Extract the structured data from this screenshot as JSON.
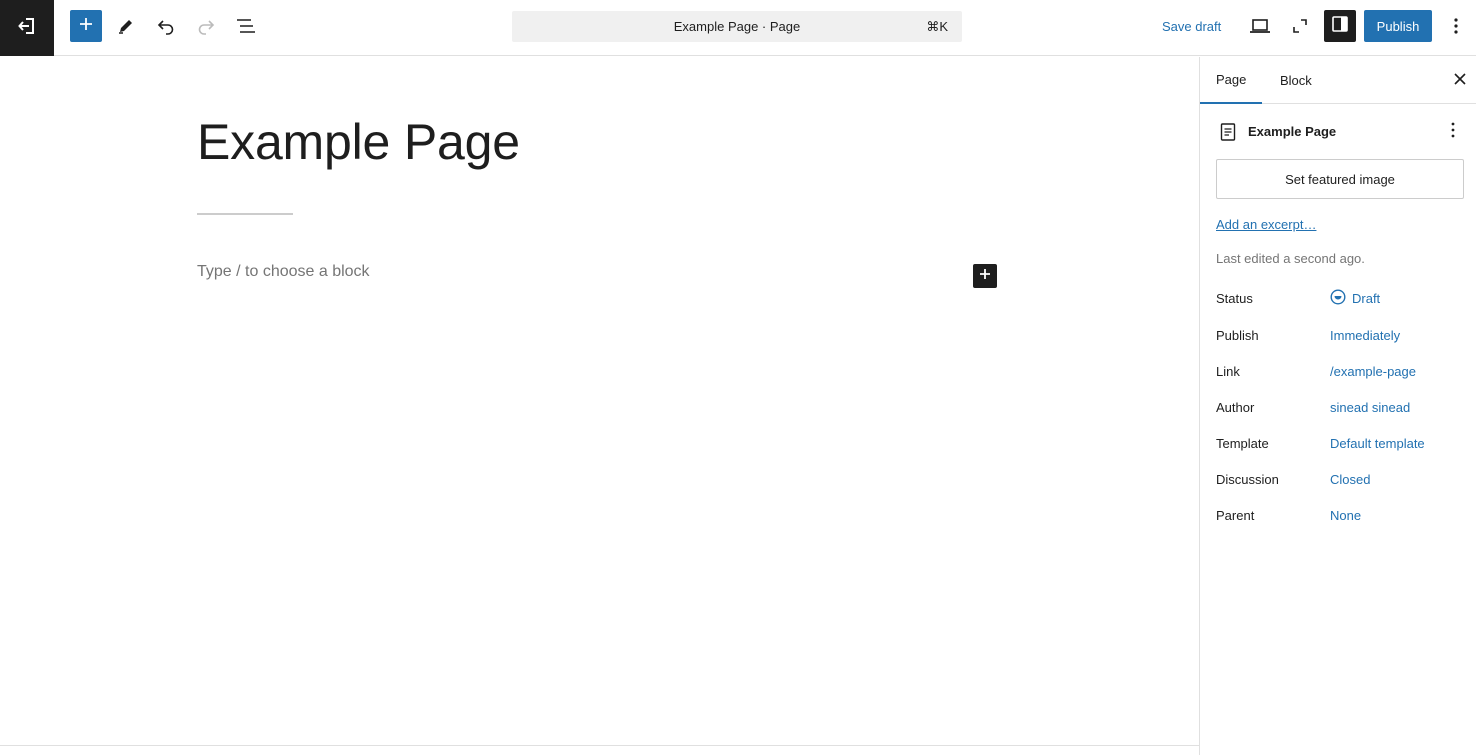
{
  "topbar": {
    "command_bar": {
      "title": "Example Page · Page",
      "shortcut": "⌘K"
    },
    "save_draft_label": "Save draft",
    "publish_label": "Publish",
    "icons": [
      "back-arrow-icon",
      "plus-icon",
      "pencil-icon",
      "undo-icon",
      "redo-icon",
      "list-view-icon",
      "laptop-icon",
      "fullscreen-icon",
      "sidebar-toggle-icon",
      "more-vertical-icon"
    ]
  },
  "editor": {
    "title": "Example Page",
    "block_placeholder": "Type / to choose a block"
  },
  "sidebar": {
    "tabs": [
      {
        "label": "Page",
        "active": true
      },
      {
        "label": "Block",
        "active": false
      }
    ],
    "document": {
      "name": "Example Page"
    },
    "featured_image_label": "Set featured image",
    "excerpt_link": "Add an excerpt…",
    "last_edited": "Last edited a second ago.",
    "meta": {
      "status": {
        "label": "Status",
        "value": "Draft"
      },
      "publish": {
        "label": "Publish",
        "value": "Immediately"
      },
      "link": {
        "label": "Link",
        "value": "/example-page"
      },
      "author": {
        "label": "Author",
        "value": "sinead sinead"
      },
      "template": {
        "label": "Template",
        "value": "Default template"
      },
      "discussion": {
        "label": "Discussion",
        "value": "Closed"
      },
      "parent": {
        "label": "Parent",
        "value": "None"
      }
    }
  },
  "colors": {
    "accent": "#2271b1",
    "dark": "#1e1e1e",
    "muted": "#757575",
    "border": "#e0e0e0"
  }
}
